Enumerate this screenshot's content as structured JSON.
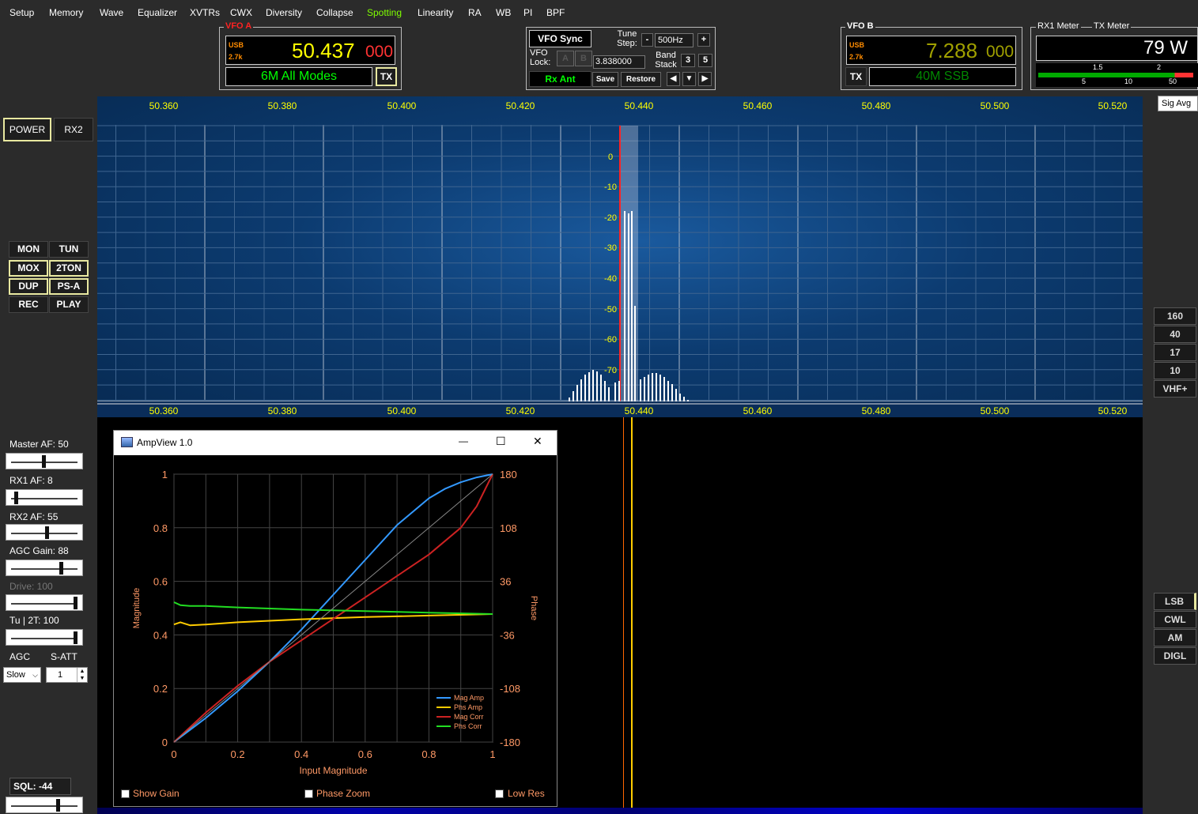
{
  "menu": {
    "items": [
      "Setup",
      "Memory",
      "Wave",
      "Equalizer",
      "XVTRs",
      "CWX",
      "Diversity",
      "Collapse",
      "Spotting",
      "Linearity",
      "RA",
      "WB",
      "PI",
      "BPF"
    ],
    "active": "Spotting"
  },
  "vfo_a": {
    "title": "VFO A",
    "mode": "USB",
    "filter": "2.7k",
    "freq_main": "50.437",
    "freq_sub": "000",
    "band_label": "6M All Modes",
    "tx_label": "TX"
  },
  "vfo_center": {
    "sync_label": "VFO Sync",
    "tune_step_label": "Tune Step:",
    "tune_minus": "-",
    "tune_step_value": "500Hz",
    "tune_plus": "+",
    "vfo_lock_label": "VFO Lock:",
    "lock_a": "A",
    "lock_b": "B",
    "lock_freq": "3.838000",
    "band_stack_label": "Band Stack",
    "band_stack_a": "3",
    "band_stack_b": "5",
    "rx_ant_label": "Rx Ant",
    "save_label": "Save",
    "restore_label": "Restore"
  },
  "vfo_b": {
    "title": "VFO B",
    "mode": "USB",
    "filter": "2.7k",
    "freq_main": "7.288",
    "freq_sub": "000",
    "band_label": "40M SSB",
    "tx_label": "TX"
  },
  "meter": {
    "rx1_label": "RX1 Meter",
    "tx_label": "TX Meter",
    "value": "79 W",
    "scale_top": [
      "1.5",
      "2"
    ],
    "scale_bottom": [
      "5",
      "10",
      "50"
    ]
  },
  "sig_avg": "Sig Avg",
  "left": {
    "power": "POWER",
    "rx2": "RX2",
    "buttons": [
      "MON",
      "TUN",
      "MOX",
      "2TON",
      "DUP",
      "PS-A",
      "REC",
      "PLAY"
    ],
    "master_af": "Master AF:  50",
    "rx1_af": "RX1 AF:  8",
    "rx2_af": "RX2 AF:  55",
    "agc_gain": "AGC Gain:  88",
    "drive": "Drive:  100",
    "tu_2t": "Tu | 2T:  100",
    "agc_label": "AGC",
    "satt_label": "S-ATT",
    "agc_value": "Slow",
    "satt_value": "1",
    "sql": "SQL:  -44"
  },
  "right_bands": [
    "160",
    "40",
    "17",
    "10",
    "VHF+"
  ],
  "right_modes": [
    "LSB",
    "CWL",
    "AM",
    "DIGL"
  ],
  "colors": {
    "accent": "#ffff00",
    "spotting_menu": "#7fff00",
    "vfo_a_freq": "#ffff00",
    "vfo_a_sub": "#ff3333",
    "vfo_b_freq": "#a0a000",
    "band_green": "#00ff00",
    "panadapter": "#0c3b70"
  },
  "panadapter": {
    "freq_labels": [
      "50.360",
      "50.380",
      "50.400",
      "50.420",
      "50.440",
      "50.460",
      "50.480",
      "50.500",
      "50.520"
    ],
    "db_labels": [
      "0",
      "-10",
      "-20",
      "-30",
      "-40",
      "-50",
      "-60",
      "-70"
    ]
  },
  "ampview": {
    "title": "AmpView 1.0",
    "minimize": "—",
    "maximize": "☐",
    "close": "✕",
    "show_gain": "Show Gain",
    "phase_zoom": "Phase Zoom",
    "low_res": "Low Res"
  },
  "chart_data": {
    "type": "line",
    "xlabel": "Input Magnitude",
    "ylabel": "Magnitude",
    "y2label": "Phase",
    "xlim": [
      0,
      1
    ],
    "ylim": [
      0,
      1
    ],
    "y2lim": [
      -180,
      180
    ],
    "x_ticks": [
      "0",
      "0.2",
      "0.4",
      "0.6",
      "0.8",
      "1"
    ],
    "y_ticks": [
      "0",
      "0.2",
      "0.4",
      "0.6",
      "0.8",
      "1"
    ],
    "y2_ticks": [
      "-180",
      "-108",
      "-36",
      "36",
      "108",
      "180"
    ],
    "grid": true,
    "legend_position": "bottom-right",
    "series": [
      {
        "name": "Mag Amp",
        "color": "#3399ff",
        "axis": "left",
        "x": [
          0,
          0.1,
          0.2,
          0.3,
          0.4,
          0.5,
          0.6,
          0.7,
          0.8,
          0.85,
          0.9,
          0.95,
          1
        ],
        "y": [
          0,
          0.09,
          0.19,
          0.3,
          0.42,
          0.55,
          0.68,
          0.81,
          0.91,
          0.945,
          0.97,
          0.988,
          1
        ]
      },
      {
        "name": "Phs Amp",
        "color": "#ffcc00",
        "axis": "right",
        "x": [
          0,
          0.02,
          0.05,
          0.1,
          0.2,
          0.4,
          0.6,
          0.8,
          1
        ],
        "y": [
          -22,
          -19,
          -23,
          -22,
          -19,
          -15,
          -12,
          -10,
          -8
        ]
      },
      {
        "name": "Mag Corr",
        "color": "#cc2222",
        "axis": "left",
        "x": [
          0,
          0.1,
          0.2,
          0.3,
          0.4,
          0.5,
          0.6,
          0.7,
          0.8,
          0.9,
          0.95,
          1
        ],
        "y": [
          0,
          0.11,
          0.21,
          0.3,
          0.38,
          0.46,
          0.54,
          0.62,
          0.7,
          0.8,
          0.88,
          1
        ]
      },
      {
        "name": "Phs Corr",
        "color": "#22dd22",
        "axis": "right",
        "x": [
          0,
          0.02,
          0.05,
          0.1,
          0.2,
          0.4,
          0.6,
          0.8,
          1
        ],
        "y": [
          8,
          4,
          3,
          3,
          1,
          -2,
          -4,
          -6,
          -8
        ]
      },
      {
        "name": "",
        "color": "#888888",
        "axis": "left",
        "x": [
          0,
          1
        ],
        "y": [
          0,
          1
        ]
      }
    ]
  }
}
